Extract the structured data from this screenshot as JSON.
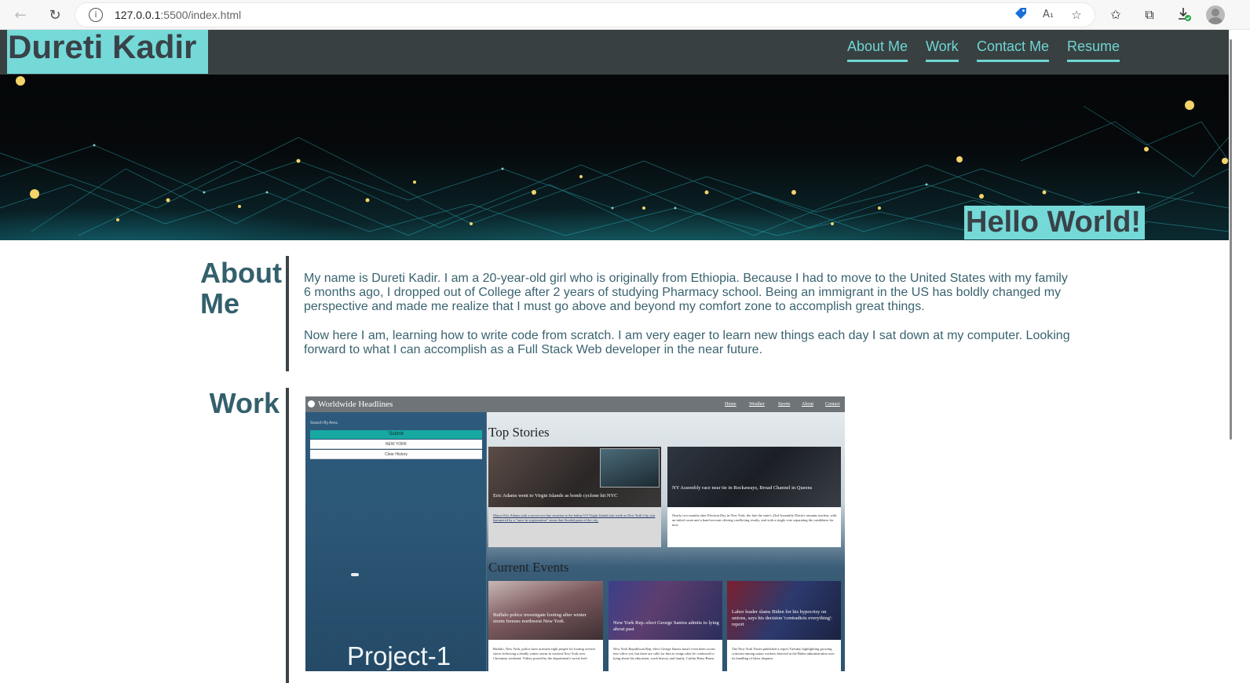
{
  "browser": {
    "url_host": "127.0.0.1",
    "url_rest": ":5500/index.html",
    "icons": [
      "back-arrow-icon",
      "reload-icon",
      "site-info-icon",
      "tag-icon",
      "read-aloud-icon",
      "add-favorite-icon",
      "favorites-icon",
      "collections-icon",
      "downloads-icon",
      "profile-avatar-icon"
    ]
  },
  "header": {
    "title": "Dureti Kadir",
    "nav": [
      "About Me",
      "Work",
      "Contact Me",
      "Resume"
    ]
  },
  "hero": {
    "greeting": "Hello World!"
  },
  "about": {
    "heading_line1": "About",
    "heading_line2": "Me",
    "paragraphs": [
      "My name is Dureti Kadir. I am a 20-year-old girl who is originally from Ethiopia. Because I had to move to the United States with my family 6 months ago, I dropped out of College after 2 years of studying Pharmacy school. Being an immigrant in the US has boldly changed my perspective and made me realize that I must go above and beyond my comfort zone to accomplish great things.",
      "Now here I am, learning how to write code from scratch. I am very eager to learn new things each day I sat down at my computer. Looking forward to what I can accomplish as a Full Stack Web developer in the near future."
    ]
  },
  "work": {
    "heading": "Work",
    "project": {
      "label": "Project-1",
      "app_title": "Worldwide Headlines",
      "app_nav": [
        "Home",
        "Weather",
        "Sports",
        "About",
        "Contact"
      ],
      "search_hint": "Search By Area",
      "submit_label": "Submit",
      "history_items": [
        "NEW YORK",
        "Clear History"
      ],
      "top_stories_title": "Top Stories",
      "current_events_title": "Current Events",
      "top_stories": [
        {
          "headline": "Eric Adams went to Virgin Islands as bomb cyclone hit NYC",
          "body": "Mayor Eric Adams took a secret two-day vacation to the balmy US Virgin Islands last week as New York City was hammered by a \"once-in-a-generation\" storm that flooded parts of the city."
        },
        {
          "headline": "NY Assembly race near tie in Rockaways, Broad Channel in Queens",
          "body": "Nearly two months after Election Day in New York, the fate the state's 23rd Assembly District remains unclear, with an initial count and a hand recount offering conflicting results, and with a single vote separating the candidates for now."
        }
      ],
      "current_events": [
        {
          "headline": "Buffalo police investigate looting after winter storm freezes northwest New York",
          "body": "Buffalo, New York, police have arrested eight people for looting several stores following a deadly winter storm in western New York over Christmas weekend. Videos posted by the department's social feed"
        },
        {
          "headline": "New York Rep.-elect George Santos admits to lying about past",
          "body": "New York Republican Rep.-elect George Santos hasn't even been sworn into office yet, but there are calls for him to resign after he confessed to lying about his education, work history and family. Caitlin Huey-Burns"
        },
        {
          "headline": "Labor leader slams Biden for his hypocrisy on unions, says his decision 'contradicts everything': report",
          "body": "The New York Times published a report Tuesday highlighting growing criticism among union workers directed at the Biden administration over its handling of labor disputes."
        }
      ]
    }
  },
  "colors": {
    "accent_teal": "#75d9d8",
    "header_bg": "#384041",
    "heading_text": "#33606c",
    "body_text": "#3a6370"
  }
}
